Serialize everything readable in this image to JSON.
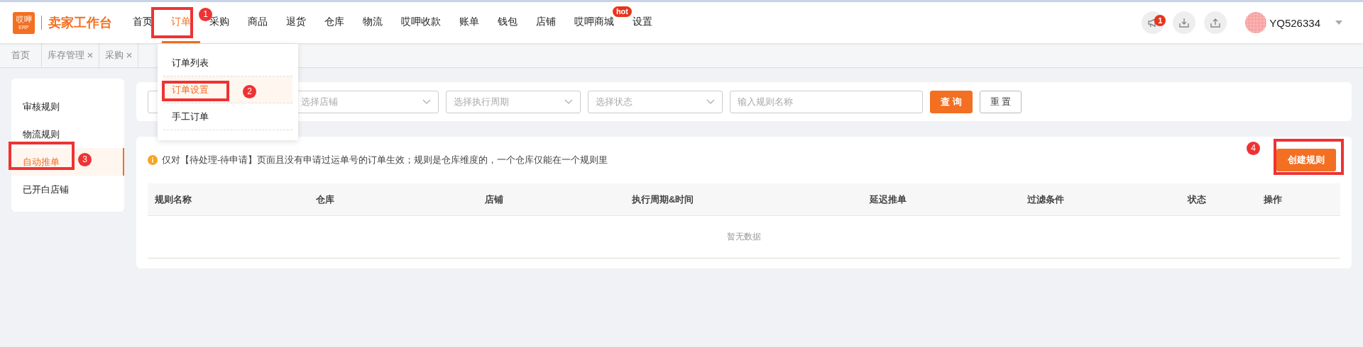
{
  "logo": {
    "mark": "哎呷",
    "badge": "ERP",
    "title": "卖家工作台"
  },
  "nav": [
    {
      "label": "首页",
      "selected": false
    },
    {
      "label": "订单",
      "selected": true
    },
    {
      "label": "采购",
      "selected": false
    },
    {
      "label": "商品",
      "selected": false
    },
    {
      "label": "退货",
      "selected": false
    },
    {
      "label": "仓库",
      "selected": false
    },
    {
      "label": "物流",
      "selected": false
    },
    {
      "label": "哎呷收款",
      "selected": false
    },
    {
      "label": "账单",
      "selected": false
    },
    {
      "label": "钱包",
      "selected": false
    },
    {
      "label": "店铺",
      "selected": false
    },
    {
      "label": "哎呷商城",
      "selected": false,
      "badge": "hot"
    },
    {
      "label": "设置",
      "selected": false
    }
  ],
  "notification_count": "1",
  "user": {
    "name": "YQ526334"
  },
  "page_tabs": [
    {
      "label": "首页",
      "closable": false
    },
    {
      "label": "库存管理",
      "closable": true
    },
    {
      "label": "采购",
      "closable": true
    }
  ],
  "dropdown": [
    {
      "label": "订单列表",
      "selected": false
    },
    {
      "label": "订单设置",
      "selected": true
    },
    {
      "label": "手工订单",
      "selected": false
    }
  ],
  "sidebar": [
    {
      "label": "审核规则",
      "selected": false
    },
    {
      "label": "物流规则",
      "selected": false
    },
    {
      "label": "自动推单",
      "selected": true
    },
    {
      "label": "已开白店铺",
      "selected": false
    }
  ],
  "filters": [
    {
      "kind": "input"
    },
    {
      "kind": "select",
      "placeholder": "选择店铺"
    },
    {
      "kind": "select",
      "placeholder": "选择执行周期"
    },
    {
      "kind": "select",
      "placeholder": "选择状态"
    },
    {
      "kind": "input",
      "placeholder": "输入规则名称"
    }
  ],
  "filter_buttons": [
    {
      "label": "查 询",
      "kind": "primary"
    },
    {
      "label": "重 置",
      "kind": "default"
    }
  ],
  "notice": "仅对【待处理-待申请】页面且没有申请过运单号的订单生效；规则是仓库维度的，一个仓库仅能在一个规则里",
  "create_button": "创建规则",
  "table": {
    "columns": [
      "规则名称",
      "仓库",
      "店铺",
      "执行周期&时间",
      "延迟推单",
      "过滤条件",
      "状态",
      "操作"
    ],
    "empty_text": "暂无数据"
  },
  "annotations": [
    {
      "number": "1"
    },
    {
      "number": "2"
    },
    {
      "number": "3"
    },
    {
      "number": "4"
    }
  ]
}
